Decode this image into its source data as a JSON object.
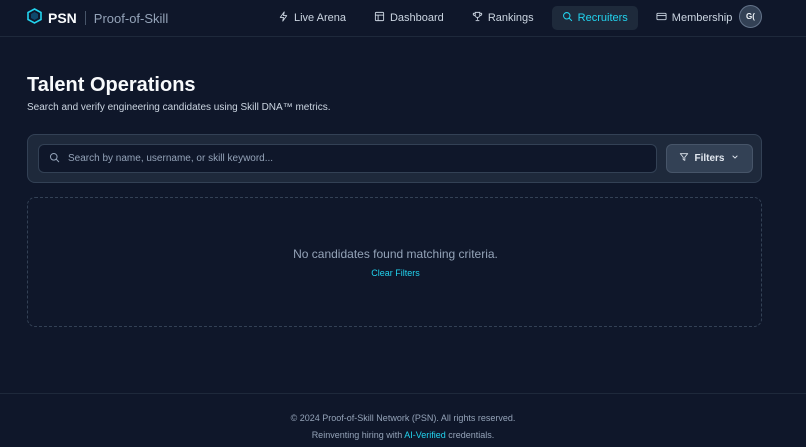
{
  "brand": {
    "name": "PSN",
    "subtitle": "Proof-of-Skill"
  },
  "nav": {
    "items": [
      {
        "label": "Live Arena",
        "icon": "bolt-icon"
      },
      {
        "label": "Dashboard",
        "icon": "layout-icon"
      },
      {
        "label": "Rankings",
        "icon": "trophy-icon"
      },
      {
        "label": "Recruiters",
        "icon": "search-icon",
        "active": true
      },
      {
        "label": "Membership",
        "icon": "card-icon"
      }
    ],
    "avatar_initials": "G("
  },
  "page": {
    "title": "Talent Operations",
    "subtitle": "Search and verify engineering candidates using Skill DNA™ metrics."
  },
  "search": {
    "placeholder": "Search by name, username, or skill keyword...",
    "value": "",
    "filters_label": "Filters"
  },
  "results": {
    "empty_message": "No candidates found matching criteria.",
    "clear_label": "Clear Filters"
  },
  "footer": {
    "copyright": "© 2024 Proof-of-Skill Network (PSN). All rights reserved.",
    "tagline_prefix": "Reinventing hiring with ",
    "tagline_highlight": "AI-Verified",
    "tagline_suffix": " credentials."
  },
  "colors": {
    "background": "#0f172a",
    "panel": "#1e293b",
    "accent": "#22d3ee",
    "text_muted": "#94a3b8"
  }
}
